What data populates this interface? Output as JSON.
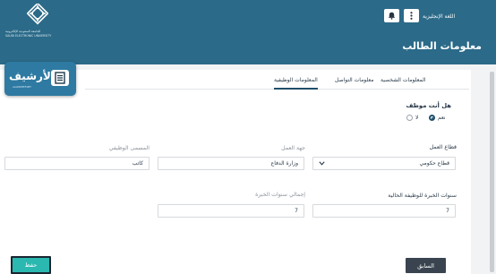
{
  "header": {
    "university_name_ar": "الجامعة السعودية الإلكترونية",
    "university_name_en": "SAUDI ELECTRONIC UNIVERSITY",
    "language_label": "اللغة الإنجليزية",
    "page_title": "معلومات الطالب"
  },
  "badge": {
    "word": "الأرشيف"
  },
  "tabs": [
    {
      "label": "المعلومات الشخصية"
    },
    {
      "label": "معلومات التواصل"
    },
    {
      "label": "المعلومات الوظيفية"
    }
  ],
  "employment": {
    "question": "هل أنت موظف",
    "options": [
      {
        "label": "نعم",
        "selected": true
      },
      {
        "label": "لا",
        "selected": false
      }
    ]
  },
  "fields": {
    "sector": {
      "label": "قطاع العمل",
      "value": "قطاع حكومي"
    },
    "employer": {
      "label": "جهة العمل",
      "value": "وزارة الدفاع"
    },
    "job_title": {
      "label": "المسمى الوظيفي",
      "value": "كاتب"
    },
    "current_years": {
      "label": "سنوات الخبرة للوظيفة الحالية",
      "value": "7"
    },
    "total_years": {
      "label": "إجمالي سنوات الخبرة",
      "value": "7"
    }
  },
  "buttons": {
    "previous": "السابق",
    "save": "حفظ"
  },
  "colors": {
    "header": "#2b6a88",
    "primary_button": "#3a4450",
    "save_button": "#2ab8b0"
  },
  "icons": [
    "university-logo-icon",
    "notification-bell-icon",
    "more-options-icon",
    "archive-icon",
    "chevron-down-icon"
  ]
}
